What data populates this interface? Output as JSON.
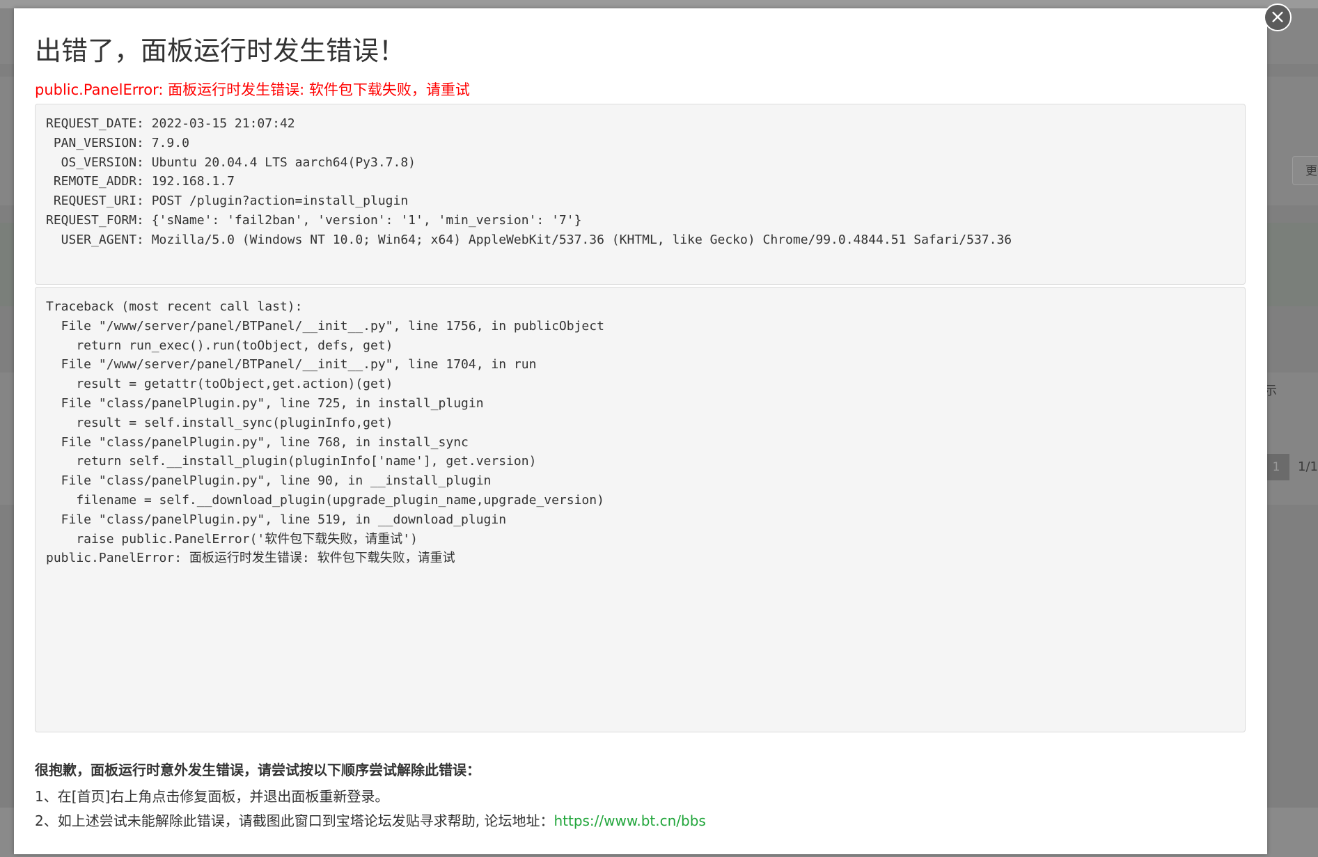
{
  "background": {
    "update_button_label": "更新",
    "display_label": "示",
    "pagination_active": "1",
    "pagination_count": "1/1"
  },
  "modal": {
    "close_icon": "×",
    "title": "出错了，面板运行时发生错误！",
    "error_message": "public.PanelError: 面板运行时发生错误: 软件包下载失败，请重试",
    "request_info": "REQUEST_DATE: 2022-03-15 21:07:42\n PAN_VERSION: 7.9.0\n  OS_VERSION: Ubuntu 20.04.4 LTS aarch64(Py3.7.8)\n REMOTE_ADDR: 192.168.1.7\n REQUEST_URI: POST /plugin?action=install_plugin\nREQUEST_FORM: {'sName': 'fail2ban', 'version': '1', 'min_version': '7'}\n  USER_AGENT: Mozilla/5.0 (Windows NT 10.0; Win64; x64) AppleWebKit/537.36 (KHTML, like Gecko) Chrome/99.0.4844.51 Safari/537.36",
    "traceback": "Traceback (most recent call last):\n  File \"/www/server/panel/BTPanel/__init__.py\", line 1756, in publicObject\n    return run_exec().run(toObject, defs, get)\n  File \"/www/server/panel/BTPanel/__init__.py\", line 1704, in run\n    result = getattr(toObject,get.action)(get)\n  File \"class/panelPlugin.py\", line 725, in install_plugin\n    result = self.install_sync(pluginInfo,get)\n  File \"class/panelPlugin.py\", line 768, in install_sync\n    return self.__install_plugin(pluginInfo['name'], get.version)\n  File \"class/panelPlugin.py\", line 90, in __install_plugin\n    filename = self.__download_plugin(upgrade_plugin_name,upgrade_version)\n  File \"class/panelPlugin.py\", line 519, in __download_plugin\n    raise public.PanelError('软件包下载失败，请重试')\npublic.PanelError: 面板运行时发生错误: 软件包下载失败，请重试",
    "help_heading": "很抱歉，面板运行时意外发生错误，请尝试按以下顺序尝试解除此错误：",
    "help_step1": "1、在[首页]右上角点击修复面板，并退出面板重新登录。",
    "help_step2_text": "2、如上述尝试未能解除此错误，请截图此窗口到宝塔论坛发贴寻求帮助, 论坛地址：",
    "forum_url": "https://www.bt.cn/bbs",
    "link_color": "#20a53a",
    "error_color": "#ff0000"
  }
}
